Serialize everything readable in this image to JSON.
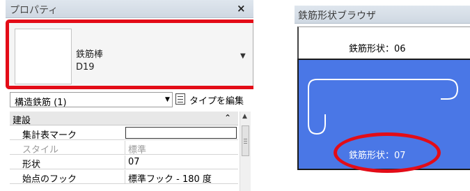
{
  "properties": {
    "title": "プロパティ",
    "close": "×",
    "type": {
      "family": "鉄筋棒",
      "name": "D19",
      "dropdown": "▼"
    },
    "filter": {
      "value": "構造鉄筋 (1)",
      "arrow": "▼"
    },
    "edit_type": "タイプを編集",
    "section": {
      "label": "建設",
      "collapse": "⌃"
    },
    "rows": [
      {
        "key": "集計表マーク",
        "value": ""
      },
      {
        "key": "スタイル",
        "value": "標準"
      },
      {
        "key": "形状",
        "value": "07"
      },
      {
        "key": "始点のフック",
        "value": "標準フック - 180 度"
      }
    ],
    "scroll_up": "▲"
  },
  "browser": {
    "title": "鉄筋形状ブラウザ",
    "items": [
      {
        "label": "鉄筋形状：06"
      },
      {
        "label": "鉄筋形状：07",
        "selected": true
      }
    ]
  },
  "colors": {
    "highlight_ring": "#e30c17",
    "selected_shape_bg": "#4a77e6"
  }
}
